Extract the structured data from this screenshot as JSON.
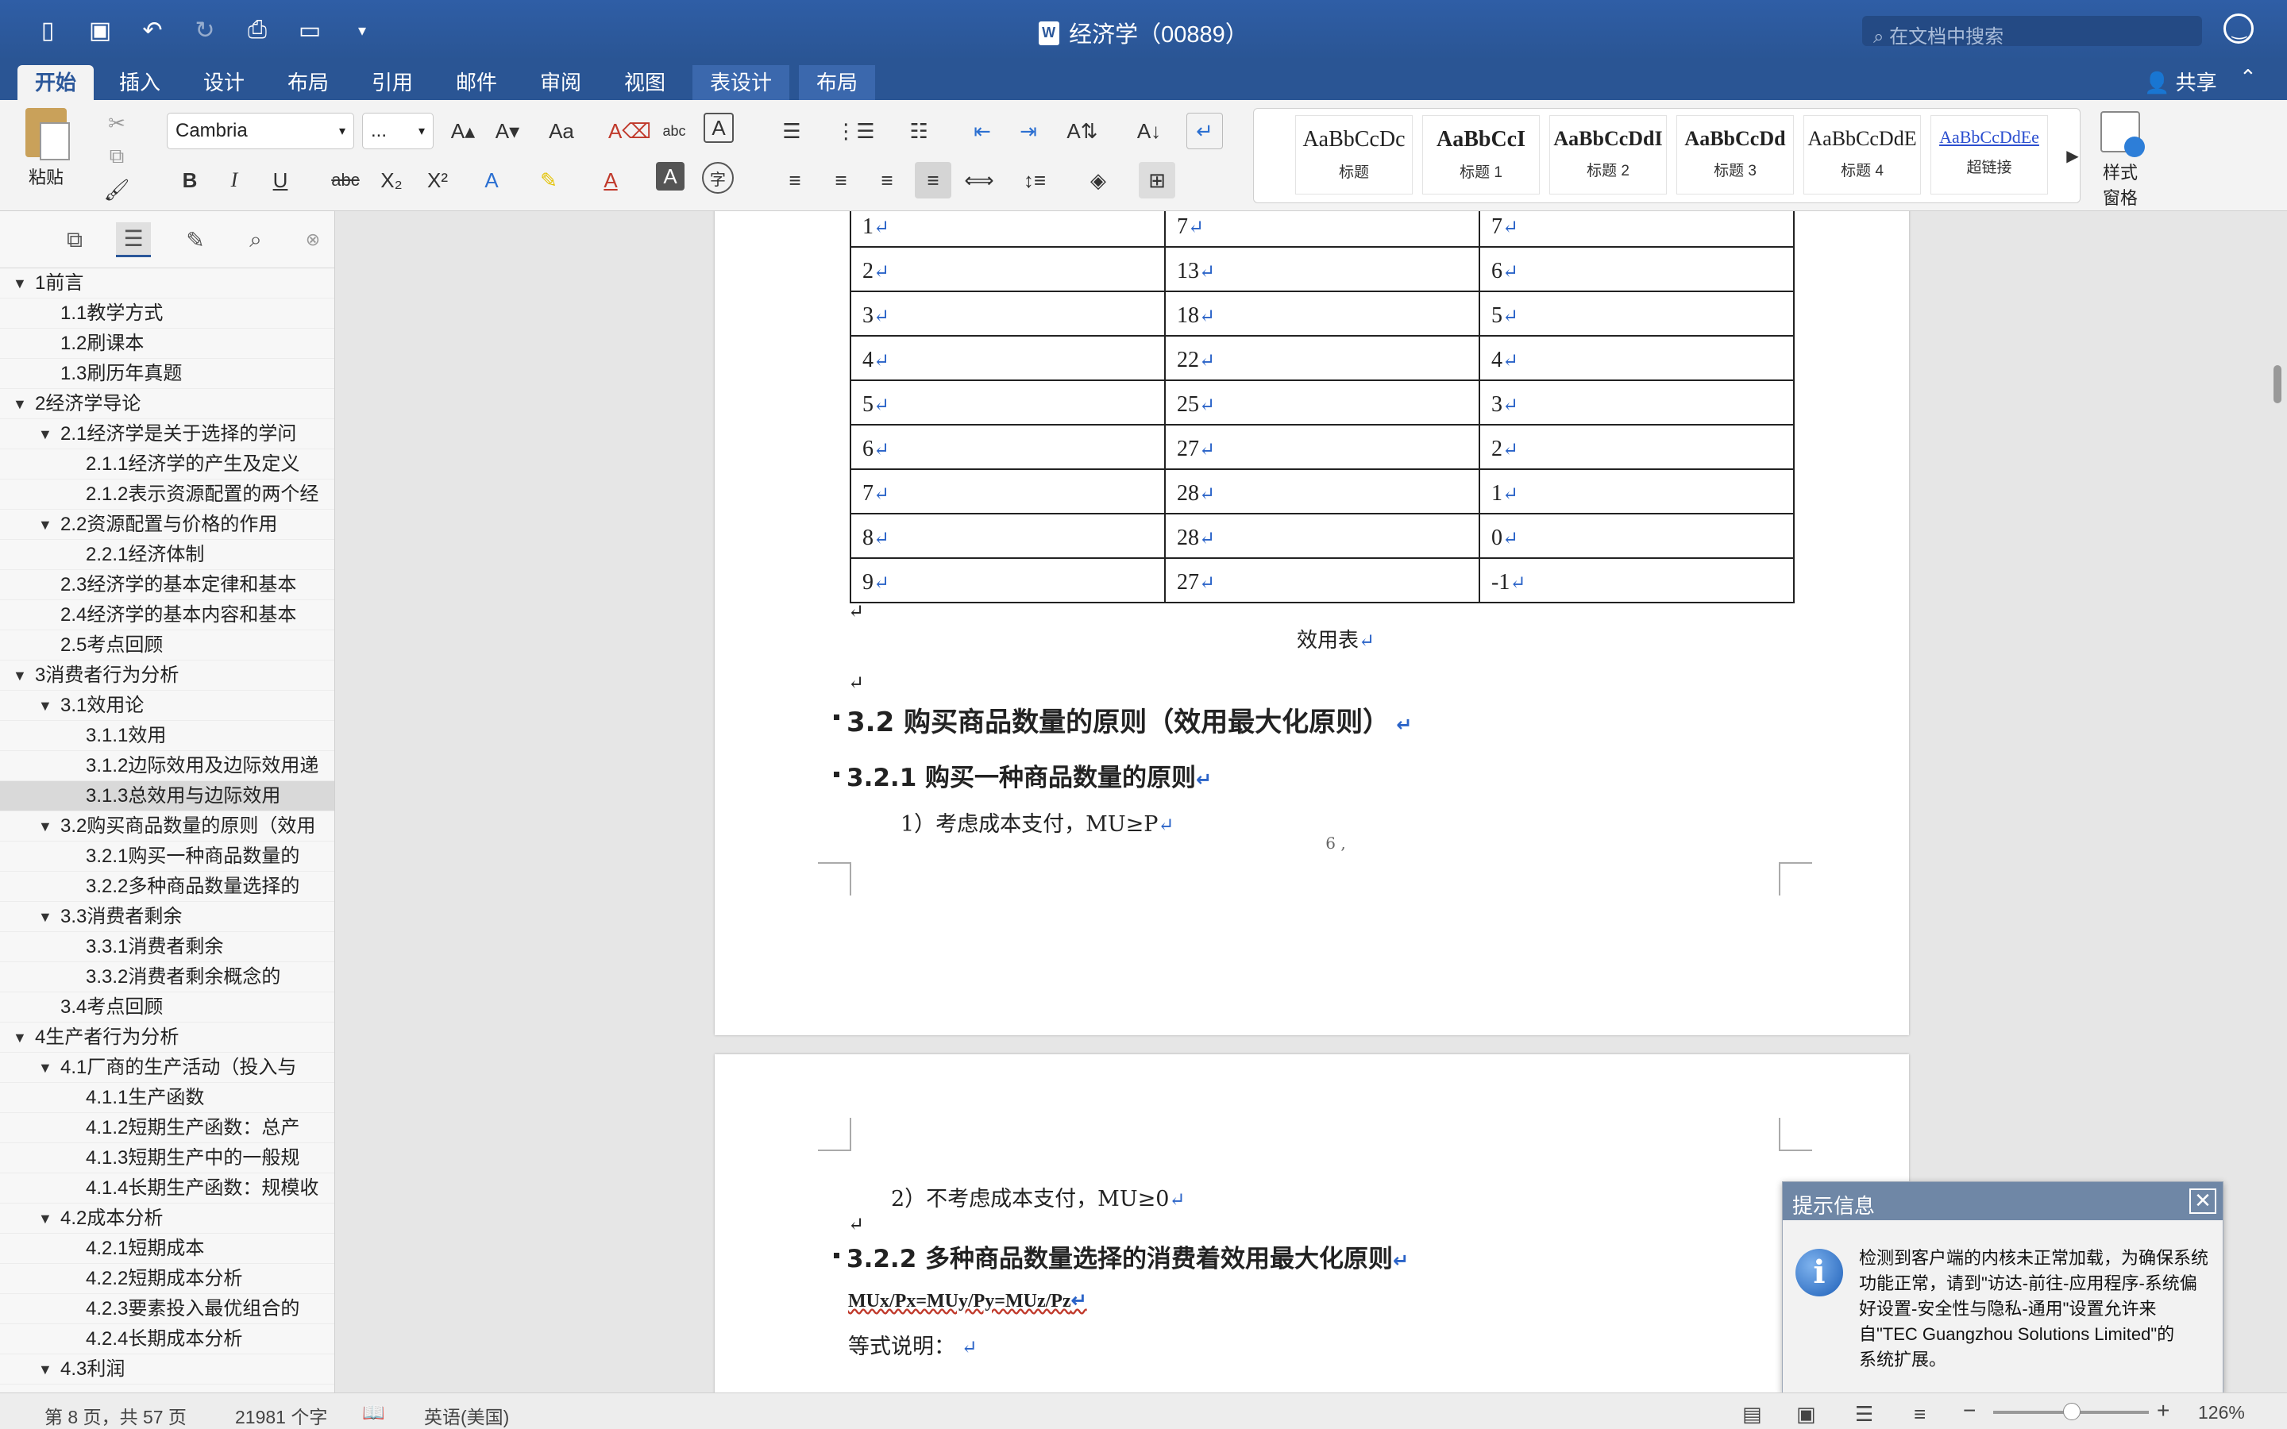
{
  "app": {
    "title": "经济学（00889）",
    "search_placeholder": "在文档中搜索",
    "share_label": "共享"
  },
  "tabs": [
    "开始",
    "插入",
    "设计",
    "布局",
    "引用",
    "邮件",
    "审阅",
    "视图",
    "表设计",
    "布局"
  ],
  "ribbon": {
    "paste_label": "粘贴",
    "font_name": "Cambria",
    "font_size": "...",
    "styles": [
      {
        "sample": "AaBbCcDc",
        "name": "标题"
      },
      {
        "sample": "AaBbCcI",
        "name": "标题 1"
      },
      {
        "sample": "AaBbCcDdI",
        "name": "标题 2"
      },
      {
        "sample": "AaBbCcDd",
        "name": "标题 3"
      },
      {
        "sample": "AaBbCcDdE",
        "name": "标题 4"
      },
      {
        "sample": "AaBbCcDdEe",
        "name": "超链接"
      }
    ],
    "styles_pane_label": "样式\n窗格"
  },
  "nav": {
    "items": [
      {
        "label": "1前言",
        "level": 0,
        "expanded": true
      },
      {
        "label": "1.1教学方式",
        "level": 1
      },
      {
        "label": "1.2刷课本",
        "level": 1
      },
      {
        "label": "1.3刷历年真题",
        "level": 1
      },
      {
        "label": "2经济学导论",
        "level": 0,
        "expanded": true
      },
      {
        "label": "2.1经济学是关于选择的学问",
        "level": 1,
        "expanded": true
      },
      {
        "label": "2.1.1经济学的产生及定义",
        "level": 2
      },
      {
        "label": "2.1.2表示资源配置的两个经",
        "level": 2
      },
      {
        "label": "2.2资源配置与价格的作用",
        "level": 1,
        "expanded": true
      },
      {
        "label": "2.2.1经济体制",
        "level": 2
      },
      {
        "label": "2.3经济学的基本定律和基本",
        "level": 1
      },
      {
        "label": "2.4经济学的基本内容和基本",
        "level": 1
      },
      {
        "label": "2.5考点回顾",
        "level": 1
      },
      {
        "label": "3消费者行为分析",
        "level": 0,
        "expanded": true
      },
      {
        "label": "3.1效用论",
        "level": 1,
        "expanded": true
      },
      {
        "label": "3.1.1效用",
        "level": 2
      },
      {
        "label": "3.1.2边际效用及边际效用递",
        "level": 2
      },
      {
        "label": "3.1.3总效用与边际效用",
        "level": 2,
        "selected": true
      },
      {
        "label": "3.2购买商品数量的原则（效用",
        "level": 1,
        "expanded": true
      },
      {
        "label": "3.2.1购买一种商品数量的",
        "level": 2
      },
      {
        "label": "3.2.2多种商品数量选择的",
        "level": 2
      },
      {
        "label": "3.3消费者剩余",
        "level": 1,
        "expanded": true
      },
      {
        "label": "3.3.1消费者剩余",
        "level": 2
      },
      {
        "label": "3.3.2消费者剩余概念的",
        "level": 2
      },
      {
        "label": "3.4考点回顾",
        "level": 1
      },
      {
        "label": "4生产者行为分析",
        "level": 0,
        "expanded": true
      },
      {
        "label": "4.1厂商的生产活动（投入与",
        "level": 1,
        "expanded": true
      },
      {
        "label": "4.1.1生产函数",
        "level": 2
      },
      {
        "label": "4.1.2短期生产函数：总产",
        "level": 2
      },
      {
        "label": "4.1.3短期生产中的一般规",
        "level": 2
      },
      {
        "label": "4.1.4长期生产函数：规模收",
        "level": 2
      },
      {
        "label": "4.2成本分析",
        "level": 1,
        "expanded": true
      },
      {
        "label": "4.2.1短期成本",
        "level": 2
      },
      {
        "label": "4.2.2短期成本分析",
        "level": 2
      },
      {
        "label": "4.2.3要素投入最优组合的",
        "level": 2
      },
      {
        "label": "4.2.4长期成本分析",
        "level": 2
      },
      {
        "label": "4.3利润",
        "level": 1,
        "expanded": true
      }
    ]
  },
  "document": {
    "table_rows": [
      [
        "1",
        "7",
        "7"
      ],
      [
        "2",
        "13",
        "6"
      ],
      [
        "3",
        "18",
        "5"
      ],
      [
        "4",
        "22",
        "4"
      ],
      [
        "5",
        "25",
        "3"
      ],
      [
        "6",
        "27",
        "2"
      ],
      [
        "7",
        "28",
        "1"
      ],
      [
        "8",
        "28",
        "0"
      ],
      [
        "9",
        "27",
        "-1"
      ]
    ],
    "table_caption": "效用表",
    "heading_32": "3.2 购买商品数量的原则（效用最大化原则）",
    "heading_321": "3.2.1 购买一种商品数量的原则",
    "point_1": "1）考虑成本支付，MU≥P",
    "page_number": "6",
    "point_2": "2）不考虑成本支付，MU≥0",
    "heading_322": "3.2.2 多种商品数量选择的消费着效用最大化原则",
    "formula": "MUx/Px=MUy/Py=MUz/Pz",
    "formula_note": "等式说明："
  },
  "dialog": {
    "title": "提示信息",
    "message": "检测到客户端的内核未正常加载，为确保系统\n功能正常，请到\"访达-前往-应用程序-系统偏\n好设置-安全性与隐私-通用\"设置允许来\n自\"TEC Guangzhou Solutions Limited\"的\n系统扩展。"
  },
  "status": {
    "page": "第 8 页，共 57 页",
    "words": "21981 个字",
    "language": "英语(美国)",
    "zoom": "126%"
  }
}
